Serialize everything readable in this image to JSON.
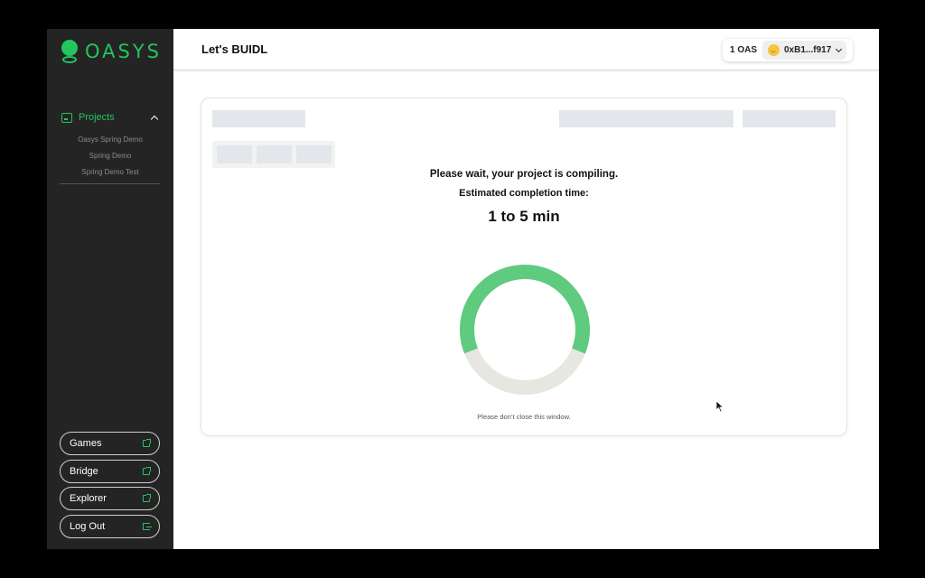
{
  "brand": {
    "name": "OASYS",
    "color": "#22c55e"
  },
  "sidebar": {
    "section": {
      "label": "Projects",
      "icon": "folder-icon",
      "expanded": true
    },
    "projects": [
      "Oasys Spring Demo",
      "Spring Demo",
      "Spring Demo Test"
    ],
    "buttons": [
      {
        "label": "Games",
        "icon": "external-link-icon"
      },
      {
        "label": "Bridge",
        "icon": "external-link-icon"
      },
      {
        "label": "Explorer",
        "icon": "external-link-icon"
      },
      {
        "label": "Log Out",
        "icon": "logout-icon"
      }
    ]
  },
  "header": {
    "title": "Let's BUIDL",
    "balance": "1 OAS",
    "address": "0xB1...f917"
  },
  "compile": {
    "message": "Please wait, your project is compiling.",
    "eta_label": "Estimated completion time:",
    "eta_value": "1 to 5 min",
    "progress": 0.62,
    "progress_color": "#5ecb7f",
    "track_color": "#e8e6e1",
    "note": "Please don’t close this window."
  }
}
